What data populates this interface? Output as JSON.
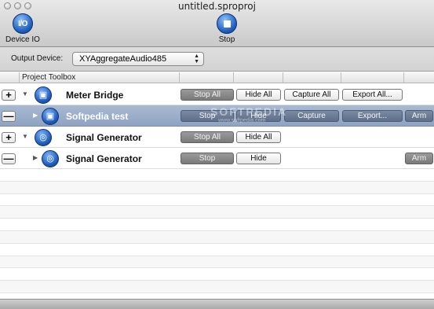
{
  "window": {
    "title": "untitled.sproproj"
  },
  "toolbar": {
    "device_io": {
      "label": "Device IO",
      "icon": "io-icon",
      "icon_text": "I/O"
    },
    "stop": {
      "label": "Stop",
      "icon": "stop-icon"
    }
  },
  "output_device": {
    "label": "Output Device:",
    "value": "XYAggregateAudio485",
    "arrows": "▲\n▼"
  },
  "table": {
    "header": "Project Toolbox"
  },
  "rows": [
    {
      "toggle": "+",
      "name": "Meter Bridge",
      "icon": "meter-icon",
      "selected": false,
      "buttons": [
        "Stop All",
        "Hide All",
        "Capture All",
        "Export All..."
      ]
    },
    {
      "toggle": "—",
      "name": "Softpedia test",
      "icon": "meter-icon",
      "selected": true,
      "buttons": [
        "Stop",
        "Hide",
        "Capture",
        "Export...",
        "Arm"
      ]
    },
    {
      "toggle": "+",
      "name": "Signal Generator",
      "icon": "signal-icon",
      "selected": false,
      "buttons": [
        "Stop All",
        "Hide All"
      ]
    },
    {
      "toggle": "—",
      "name": "Signal Generator",
      "icon": "signal-icon",
      "selected": false,
      "buttons": [
        "Stop",
        "Hide",
        "Arm"
      ]
    }
  ],
  "watermark": {
    "text": "SOFTPEDIA",
    "sub": "www.softpedia.com"
  },
  "colors": {
    "accent_blue": "#1f5fbd",
    "selection": "#98aac6"
  }
}
